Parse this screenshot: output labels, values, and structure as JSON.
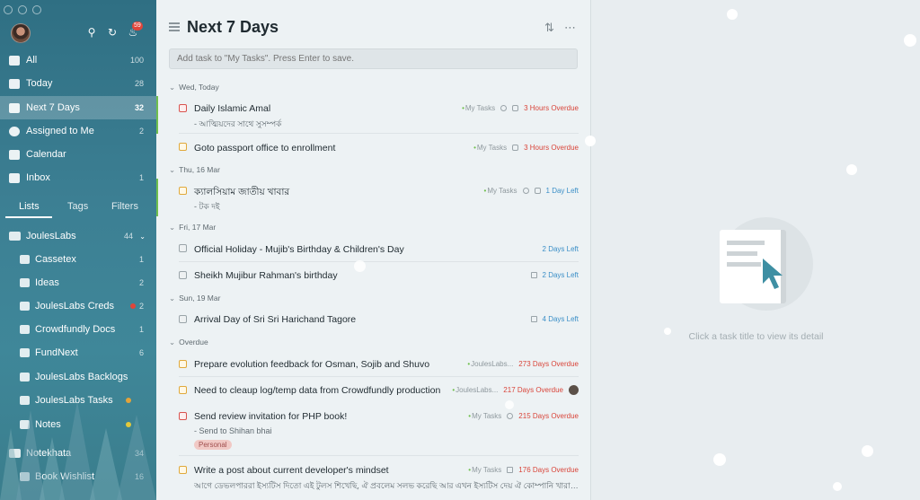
{
  "sidebar": {
    "notification_count": "59",
    "nav": [
      {
        "label": "All",
        "count": "100",
        "icon": "inbox-stack-icon"
      },
      {
        "label": "Today",
        "count": "28",
        "icon": "calendar-day-icon"
      },
      {
        "label": "Next 7 Days",
        "count": "32",
        "icon": "calendar-week-icon"
      },
      {
        "label": "Assigned to Me",
        "count": "2",
        "icon": "person-icon"
      },
      {
        "label": "Calendar",
        "count": "",
        "icon": "calendar-icon"
      },
      {
        "label": "Inbox",
        "count": "1",
        "icon": "inbox-icon"
      }
    ],
    "tabs": {
      "lists": "Lists",
      "tags": "Tags",
      "filters": "Filters"
    },
    "lists": [
      {
        "label": "JoulesLabs",
        "count": "44",
        "group": true
      },
      {
        "label": "Cassetex",
        "count": "1"
      },
      {
        "label": "Ideas",
        "count": "2"
      },
      {
        "label": "JoulesLabs Creds",
        "count": "2"
      },
      {
        "label": "Crowdfundly Docs",
        "count": "1"
      },
      {
        "label": "FundNext",
        "count": "6"
      },
      {
        "label": "JoulesLabs Backlogs",
        "count": ""
      },
      {
        "label": "JoulesLabs Tasks",
        "count": ""
      },
      {
        "label": "Notes",
        "count": ""
      },
      {
        "label": "Notekhata",
        "count": "34",
        "group": true
      },
      {
        "label": "Book Wishlist",
        "count": "16"
      }
    ]
  },
  "main": {
    "title": "Next 7 Days",
    "add_placeholder": "Add task to \"My Tasks\". Press Enter to save.",
    "sections": [
      {
        "label": "Wed, Today"
      },
      {
        "label": "Thu, 16 Mar"
      },
      {
        "label": "Fri, 17 Mar"
      },
      {
        "label": "Sun, 19 Mar"
      },
      {
        "label": "Overdue"
      }
    ],
    "tasks": [
      {
        "title": "Daily Islamic Amal",
        "sub": "- আত্মিয়দের সাথে সুসম্পর্ক",
        "list": "My Tasks",
        "due": "3 Hours Overdue"
      },
      {
        "title": "Goto passport office to enrollment",
        "list": "My Tasks",
        "due": "3 Hours Overdue"
      },
      {
        "title": "ক্যালসিয়াম জাতীয় খাবার",
        "sub": "- টক দই",
        "list": "My Tasks",
        "due": "1 Day Left"
      },
      {
        "title": "Official Holiday - Mujib's Birthday & Children's Day",
        "due": "2 Days Left"
      },
      {
        "title": "Sheikh Mujibur Rahman's birthday",
        "due": "2 Days Left"
      },
      {
        "title": "Arrival Day of Sri Sri Harichand Tagore",
        "due": "4 Days Left"
      },
      {
        "title": "Prepare evolution feedback for Osman, Sojib and Shuvo",
        "list": "JoulesLabs...",
        "due": "273 Days Overdue"
      },
      {
        "title": "Need to cleaup log/temp data from Crowdfundly production",
        "list": "JoulesLabs...",
        "due": "217 Days Overdue"
      },
      {
        "title": "Send review invitation for PHP book!",
        "sub": "- Send to Shihan bhai",
        "tag": "Personal",
        "list": "My Tasks",
        "due": "215 Days Overdue"
      },
      {
        "title": "Write a post about current developer's mindset",
        "sub": "আগে ডেভলপাররা ইস্যটিস দিতো এই টুলস শিখেছি, ঐ প্রবলেম সলভ করেছি আর এখন ইস্যটিস দেয় ঐ কোম্পানি খারাপ, সেই কো...",
        "list": "My Tasks",
        "due": "176 Days Overdue"
      }
    ]
  },
  "detail": {
    "empty_text": "Click a task title to view its detail"
  }
}
